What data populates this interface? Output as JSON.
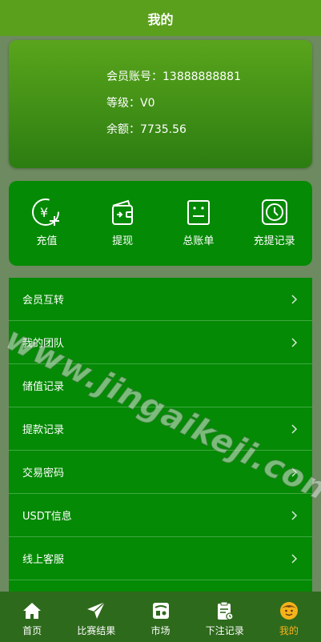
{
  "header": {
    "title": "我的"
  },
  "account": {
    "member_line": "会员账号：13888888881",
    "level_line": "等级：V0",
    "balance_line": "余额：7735.56"
  },
  "actions": [
    {
      "label": "充值",
      "icon": "yen-plus-icon"
    },
    {
      "label": "提现",
      "icon": "wallet-icon"
    },
    {
      "label": "总账单",
      "icon": "bill-icon"
    },
    {
      "label": "充提记录",
      "icon": "clock-icon"
    }
  ],
  "menu": [
    {
      "label": "会员互转",
      "chevron": true
    },
    {
      "label": "我的团队",
      "chevron": true
    },
    {
      "label": "储值记录",
      "chevron": false
    },
    {
      "label": "提款记录",
      "chevron": true
    },
    {
      "label": "交易密码",
      "chevron": true
    },
    {
      "label": "USDT信息",
      "chevron": true
    },
    {
      "label": "线上客服",
      "chevron": true
    }
  ],
  "watermark": "www.jingaikeji.com",
  "tabs": [
    {
      "label": "首页",
      "icon": "home-icon"
    },
    {
      "label": "比赛结果",
      "icon": "send-icon"
    },
    {
      "label": "市场",
      "icon": "market-icon"
    },
    {
      "label": "下注记录",
      "icon": "clipboard-icon"
    },
    {
      "label": "我的",
      "icon": "smiley-icon",
      "active": true
    }
  ],
  "colors": {
    "header": "#5aa01c",
    "card": "#058a05",
    "tabbar": "#2e6a1c",
    "active_tab": "#f5b21b"
  }
}
